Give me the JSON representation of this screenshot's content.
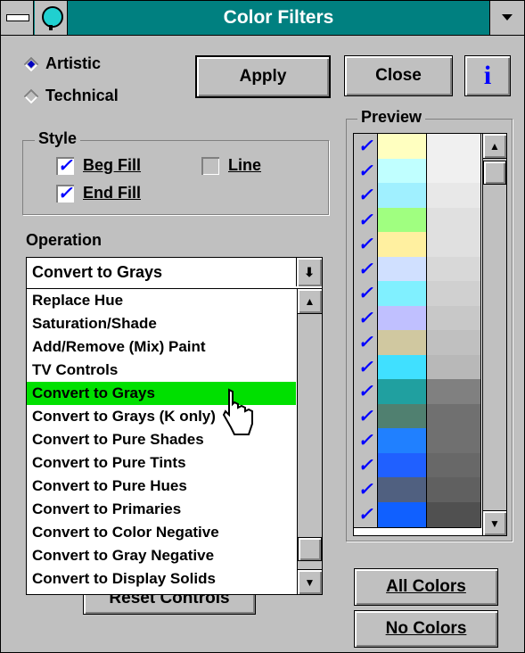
{
  "window": {
    "title": "Color Filters"
  },
  "mode": {
    "artistic_label": "Artistic",
    "technical_label": "Technical",
    "selected": "Artistic"
  },
  "buttons": {
    "apply": "Apply",
    "close": "Close",
    "info": "i",
    "reset": "Reset Controls",
    "all_colors": "All Colors",
    "no_colors": "No Colors"
  },
  "style": {
    "label": "Style",
    "beg_fill": {
      "label": "Beg Fill",
      "checked": true
    },
    "line": {
      "label": "Line",
      "checked": false
    },
    "end_fill": {
      "label": "End Fill",
      "checked": true
    }
  },
  "operation": {
    "label": "Operation",
    "selected": "Convert to Grays",
    "items": [
      "Replace Hue",
      "Saturation/Shade",
      "Add/Remove (Mix) Paint",
      "TV Controls",
      "Convert to Grays",
      "Convert to Grays (K only)",
      "Convert to Pure Shades",
      "Convert to Pure Tints",
      "Convert to Pure Hues",
      "Convert to Primaries",
      "Convert to Color Negative",
      "Convert to Gray Negative",
      "Convert to Display Solids"
    ]
  },
  "preview": {
    "label": "Preview",
    "rows": [
      {
        "checked": true,
        "color": "#ffffc0",
        "gray": "#f0f0f0"
      },
      {
        "checked": true,
        "color": "#c0ffff",
        "gray": "#f0f0f0"
      },
      {
        "checked": true,
        "color": "#a0f0ff",
        "gray": "#e8e8e8"
      },
      {
        "checked": true,
        "color": "#a0ff80",
        "gray": "#e0e0e0"
      },
      {
        "checked": true,
        "color": "#fff0a0",
        "gray": "#e0e0e0"
      },
      {
        "checked": true,
        "color": "#d0e0ff",
        "gray": "#d8d8d8"
      },
      {
        "checked": true,
        "color": "#80f0ff",
        "gray": "#d0d0d0"
      },
      {
        "checked": true,
        "color": "#c0c0ff",
        "gray": "#c8c8c8"
      },
      {
        "checked": true,
        "color": "#d0c8a0",
        "gray": "#c0c0c0"
      },
      {
        "checked": true,
        "color": "#40e0ff",
        "gray": "#b8b8b8"
      },
      {
        "checked": true,
        "color": "#20a0a0",
        "gray": "#808080"
      },
      {
        "checked": true,
        "color": "#508070",
        "gray": "#707070"
      },
      {
        "checked": true,
        "color": "#2080ff",
        "gray": "#707070"
      },
      {
        "checked": true,
        "color": "#2060ff",
        "gray": "#686868"
      },
      {
        "checked": true,
        "color": "#506080",
        "gray": "#606060"
      },
      {
        "checked": true,
        "color": "#1060ff",
        "gray": "#505050"
      }
    ]
  },
  "colors": {
    "title_bar": "#008080",
    "face": "#c0c0c0",
    "selection": "#00e000",
    "check": "#0000ff"
  }
}
